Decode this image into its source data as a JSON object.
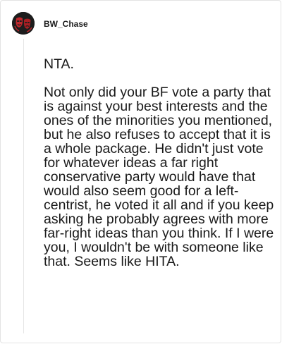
{
  "comment": {
    "username": "BW_Chase",
    "avatar_icon": "red-mask-avatar-icon",
    "paragraphs": [
      "NTA.",
      "Not only did your BF vote a party that is against your best interests and the ones of the minorities you mentioned, but he also refuses to accept that it is a whole package. He didn't just vote for whatever ideas a far right conservative party would have that would also seem good for a left-centrist, he voted it all and if you keep asking he probably agrees with more far-right ideas than you think. If I were you, I wouldn't be with someone like that. Seems like HITA."
    ]
  },
  "colors": {
    "avatar_background": "#1d1d1d",
    "avatar_accent": "#c0282d",
    "border": "#e3e3e3",
    "text": "#1a1a1a"
  }
}
